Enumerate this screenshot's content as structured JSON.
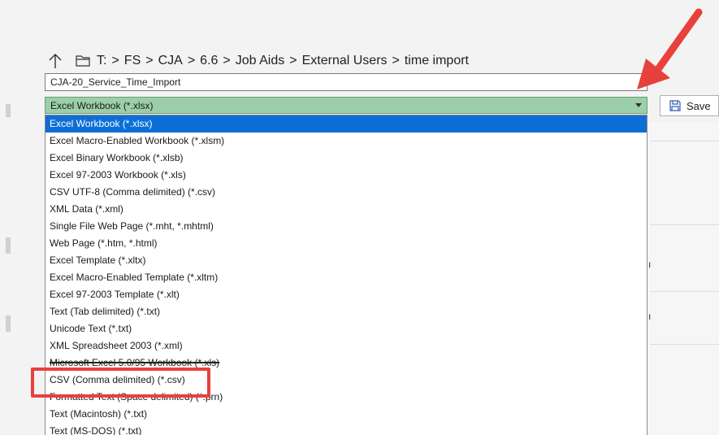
{
  "path": {
    "crumbs": [
      "T:",
      "FS",
      "CJA",
      "6.6",
      "Job Aids",
      "External Users",
      "time import"
    ],
    "separator": ">"
  },
  "filename": {
    "value": "CJA-20_Service_Time_Import"
  },
  "save_type": {
    "selected": "Excel Workbook (*.xlsx)"
  },
  "save_button": {
    "label": "Save"
  },
  "dropdown_options": [
    "Excel Workbook (*.xlsx)",
    "Excel Macro-Enabled Workbook (*.xlsm)",
    "Excel Binary Workbook (*.xlsb)",
    "Excel 97-2003 Workbook (*.xls)",
    "CSV UTF-8 (Comma delimited) (*.csv)",
    "XML Data (*.xml)",
    "Single File Web Page (*.mht, *.mhtml)",
    "Web Page (*.htm, *.html)",
    "Excel Template (*.xltx)",
    "Excel Macro-Enabled Template (*.xltm)",
    "Excel 97-2003 Template (*.xlt)",
    "Text (Tab delimited) (*.txt)",
    "Unicode Text (*.txt)",
    "XML Spreadsheet 2003 (*.xml)",
    "Microsoft Excel 5.0/95 Workbook (*.xls)",
    "CSV (Comma delimited) (*.csv)",
    "Formatted Text (Space delimited) (*.prn)",
    "Text (Macintosh) (*.txt)",
    "Text (MS-DOS) (*.txt)"
  ],
  "selected_index": 0,
  "highlighted_option": "CSV (Comma delimited) (*.csv)",
  "colors": {
    "select_bg": "#9ccfa9",
    "selected_option": "#0d6fd6",
    "annotation": "#e8413c"
  },
  "icons": {
    "up": "up-arrow-icon",
    "folder": "folder-icon",
    "dropdown": "chevron-down-icon",
    "save": "save-icon"
  }
}
